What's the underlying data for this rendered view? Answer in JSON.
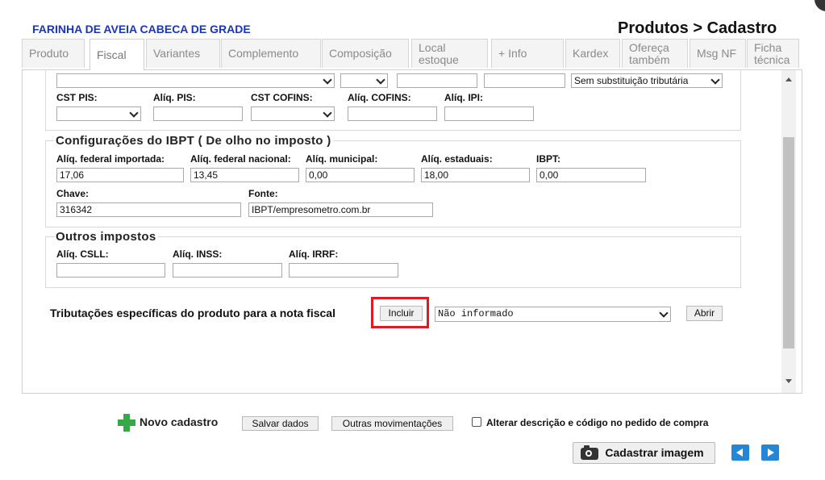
{
  "header": {
    "product_name": "FARINHA DE AVEIA CABECA DE GRADE",
    "page_heading": "Produtos > Cadastro"
  },
  "tabs": [
    {
      "label": "Produto"
    },
    {
      "label": "Fiscal",
      "active": true
    },
    {
      "label": "Variantes"
    },
    {
      "label": "Complemento"
    },
    {
      "label": "Composição"
    },
    {
      "label": "Local estoque"
    },
    {
      "label": "+ Info"
    },
    {
      "label": "Kardex"
    },
    {
      "label": "Ofereça também"
    },
    {
      "label": "Msg NF"
    },
    {
      "label": "Ficha técnica"
    }
  ],
  "tax_section": {
    "top_row": {
      "substitution_select": "Sem substituição tributária"
    },
    "labels": {
      "cst_pis": "CST PIS:",
      "aliq_pis": "Alíq. PIS:",
      "cst_cofins": "CST COFINS:",
      "aliq_cofins": "Alíq. COFINS:",
      "aliq_ipi": "Alíq. IPI:"
    },
    "values": {
      "aliq_pis": "",
      "aliq_cofins": "",
      "aliq_ipi": ""
    }
  },
  "ibpt": {
    "legend": "Configurações do IBPT ( De olho no imposto )",
    "labels": {
      "federal_importada": "Alíq. federal importada:",
      "federal_nacional": "Alíq. federal nacional:",
      "municipal": "Alíq. municipal:",
      "estaduais": "Alíq. estaduais:",
      "ibpt": "IBPT:",
      "chave": "Chave:",
      "fonte": "Fonte:"
    },
    "values": {
      "federal_importada": "17,06",
      "federal_nacional": "13,45",
      "municipal": "0,00",
      "estaduais": "18,00",
      "ibpt": "0,00",
      "chave": "316342",
      "fonte": "IBPT/empresometro.com.br"
    }
  },
  "outros": {
    "legend": "Outros impostos",
    "labels": {
      "csll": "Alíq. CSLL:",
      "inss": "Alíq. INSS:",
      "irrf": "Alíq. IRRF:"
    },
    "values": {
      "csll": "",
      "inss": "",
      "irrf": ""
    }
  },
  "tributacoes": {
    "label": "Tributações específicas do produto para a nota fiscal",
    "include_button": "Incluir",
    "select_value": "Não informado",
    "open_button": "Abrir"
  },
  "footer": {
    "new_record": "Novo cadastro",
    "save": "Salvar dados",
    "other_moves": "Outras movimentações",
    "checkbox_label": "Alterar descrição e código no pedido de compra",
    "register_image": "Cadastrar imagem"
  },
  "colors": {
    "product_name": "#1a35b8",
    "highlight": "#e21b23",
    "nav_button": "#2387d8",
    "plus_icon": "#36a845"
  },
  "icons": [
    "plus-icon",
    "camera-icon",
    "prev-arrow-icon",
    "next-arrow-icon",
    "chevron-down-icon"
  ]
}
